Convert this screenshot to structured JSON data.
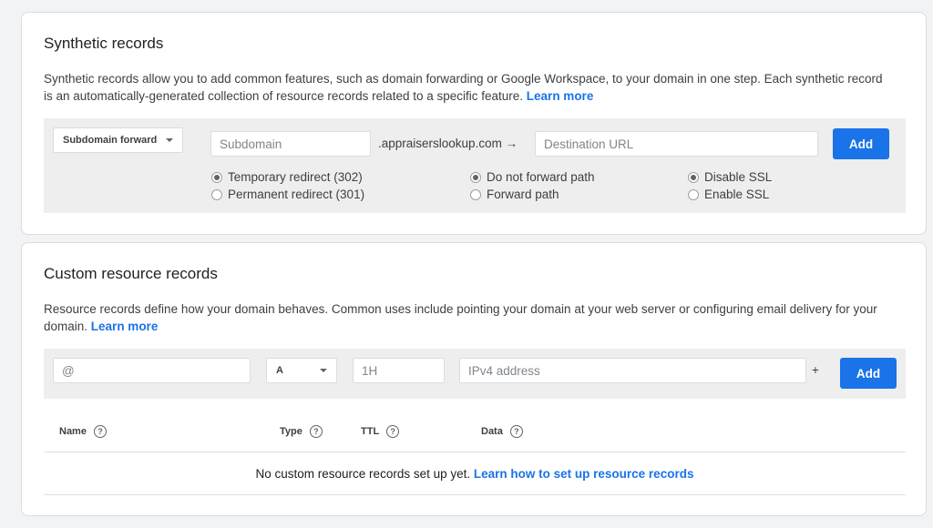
{
  "synthetic": {
    "title": "Synthetic records",
    "desc": "Synthetic records allow you to add common features, such as domain forwarding or Google Workspace, to your domain in one step. Each synthetic record is an automatically-generated collection of resource records related to a specific feature.",
    "learn_more": "Learn more",
    "type_dropdown": "Subdomain forward",
    "subdomain_placeholder": "Subdomain",
    "domain_suffix": ".appraiserslookup.com →",
    "destination_placeholder": "Destination URL",
    "add_label": "Add",
    "redirect_options": [
      {
        "label": "Temporary redirect (302)",
        "checked": true
      },
      {
        "label": "Permanent redirect (301)",
        "checked": false
      }
    ],
    "path_options": [
      {
        "label": "Do not forward path",
        "checked": true
      },
      {
        "label": "Forward path",
        "checked": false
      }
    ],
    "ssl_options": [
      {
        "label": "Disable SSL",
        "checked": true
      },
      {
        "label": "Enable SSL",
        "checked": false
      }
    ]
  },
  "custom": {
    "title": "Custom resource records",
    "desc": "Resource records define how your domain behaves. Common uses include pointing your domain at your web server or configuring email delivery for your domain.",
    "learn_more": "Learn more",
    "host_placeholder": "@",
    "type_dropdown": "A",
    "ttl_placeholder": "1H",
    "data_placeholder": "IPv4 address",
    "plus": "+",
    "add_label": "Add",
    "columns": [
      "Name",
      "Type",
      "TTL",
      "Data"
    ],
    "help_glyph": "?",
    "empty_text": "No custom resource records set up yet.",
    "empty_link": "Learn how to set up resource records"
  },
  "colors": {
    "accent": "#1a73e8",
    "panel": "#eeeeee"
  }
}
